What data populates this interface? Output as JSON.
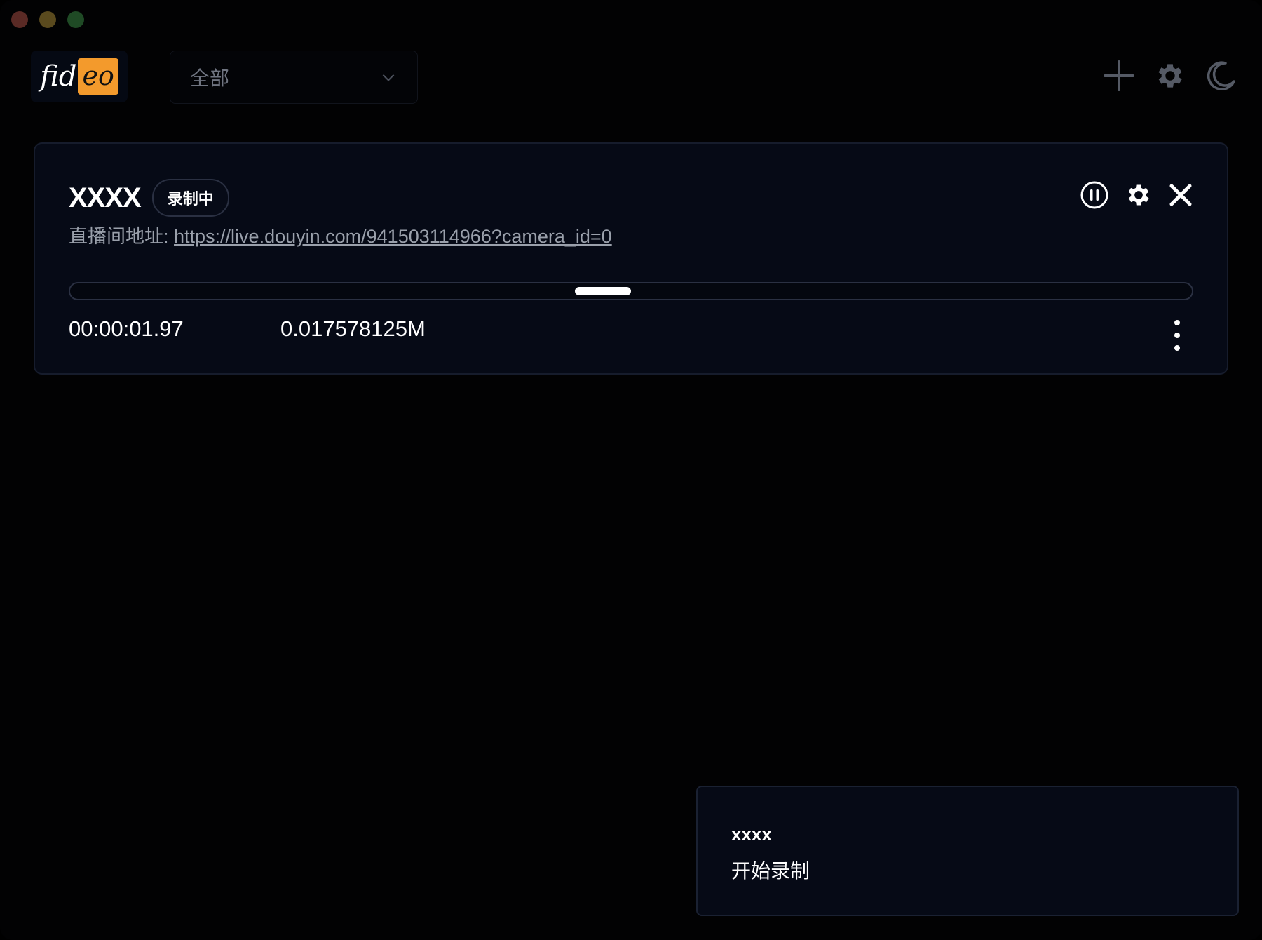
{
  "app": {
    "logo_left": "fid",
    "logo_right": "eo"
  },
  "filter": {
    "selected": "全部"
  },
  "header_icons": [
    "add-icon",
    "gear-icon",
    "moon-icon"
  ],
  "recording": {
    "title": "XXXX",
    "status": "录制中",
    "url_label": "直播间地址: ",
    "url": "https://live.douyin.com/941503114966?camera_id=0",
    "progress_fraction": 0.475,
    "duration": "00:00:01.97",
    "size": "0.017578125M",
    "action_icons": [
      "pause-icon",
      "gear-icon",
      "close-icon"
    ]
  },
  "toast": {
    "title": "xxxx",
    "message": "开始录制"
  },
  "colors": {
    "background": "#020203",
    "card": "#060a16",
    "border": "#2a3042",
    "logo_accent": "#f39a2c",
    "text": "#ffffff",
    "muted": "#9aa0ab"
  }
}
